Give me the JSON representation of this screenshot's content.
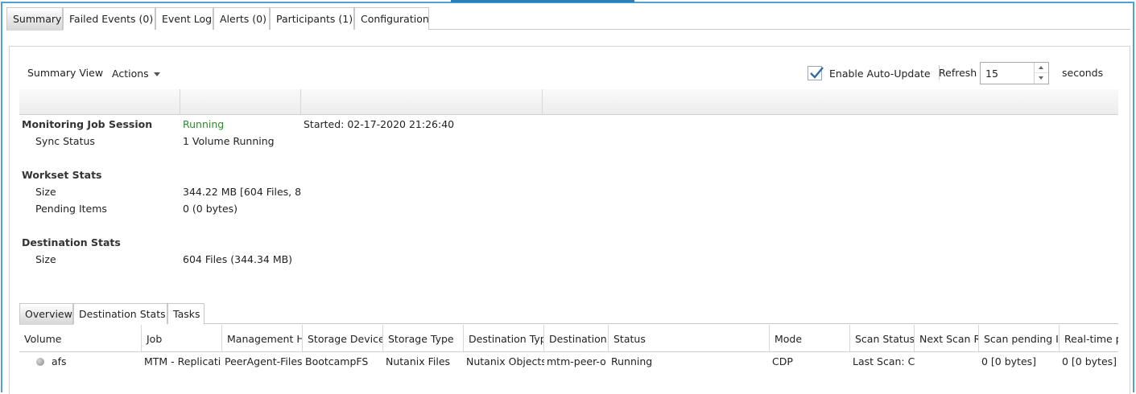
{
  "top_tabs": [
    {
      "label": "Summary"
    },
    {
      "label": "Failed Events (0)"
    },
    {
      "label": "Event Log"
    },
    {
      "label": "Alerts (0)"
    },
    {
      "label": "Participants (1)"
    },
    {
      "label": "Configuration"
    }
  ],
  "toolbar": {
    "summary_view": "Summary View",
    "actions": "Actions",
    "auto_update_label": "Enable Auto-Update",
    "refresh_label": "Refresh",
    "refresh_value": "15",
    "seconds_label": "seconds"
  },
  "summary": {
    "session_label": "Monitoring Job Session",
    "session_status": "Running",
    "started": "Started: 02-17-2020 21:26:40",
    "sync_status_label": "Sync Status",
    "sync_status_value": "1 Volume Running",
    "workset_heading": "Workset Stats",
    "workset_size_label": "Size",
    "workset_size_value": "344.22 MB [604 Files, 8",
    "pending_label": "Pending Items",
    "pending_value": "0 (0 bytes)",
    "dest_heading": "Destination Stats",
    "dest_size_label": "Size",
    "dest_size_value": "604 Files (344.34 MB)"
  },
  "sub_tabs": [
    {
      "label": "Overview"
    },
    {
      "label": "Destination Stats"
    },
    {
      "label": "Tasks"
    }
  ],
  "grid": {
    "columns": [
      "Volume",
      "Job",
      "Management Ho",
      "Storage Device",
      "Storage Type",
      "Destination Type",
      "Destination",
      "Status",
      "Mode",
      "Scan Status",
      "Next Scan R",
      "Scan pending I",
      "Real-time p"
    ],
    "rows": [
      [
        "afs",
        "MTM - Replicati",
        "PeerAgent-Files",
        "BootcampFS",
        "Nutanix Files",
        "Nutanix Objects",
        "mtm-peer-o",
        "Running",
        "CDP",
        "Last Scan: C",
        "",
        "0 [0 bytes]",
        "0 [0 bytes]"
      ]
    ]
  },
  "colors": {
    "frame_border": "#4aa3d3",
    "running_green": "#2f8a2f",
    "checkbox_check": "#2e6da4"
  }
}
